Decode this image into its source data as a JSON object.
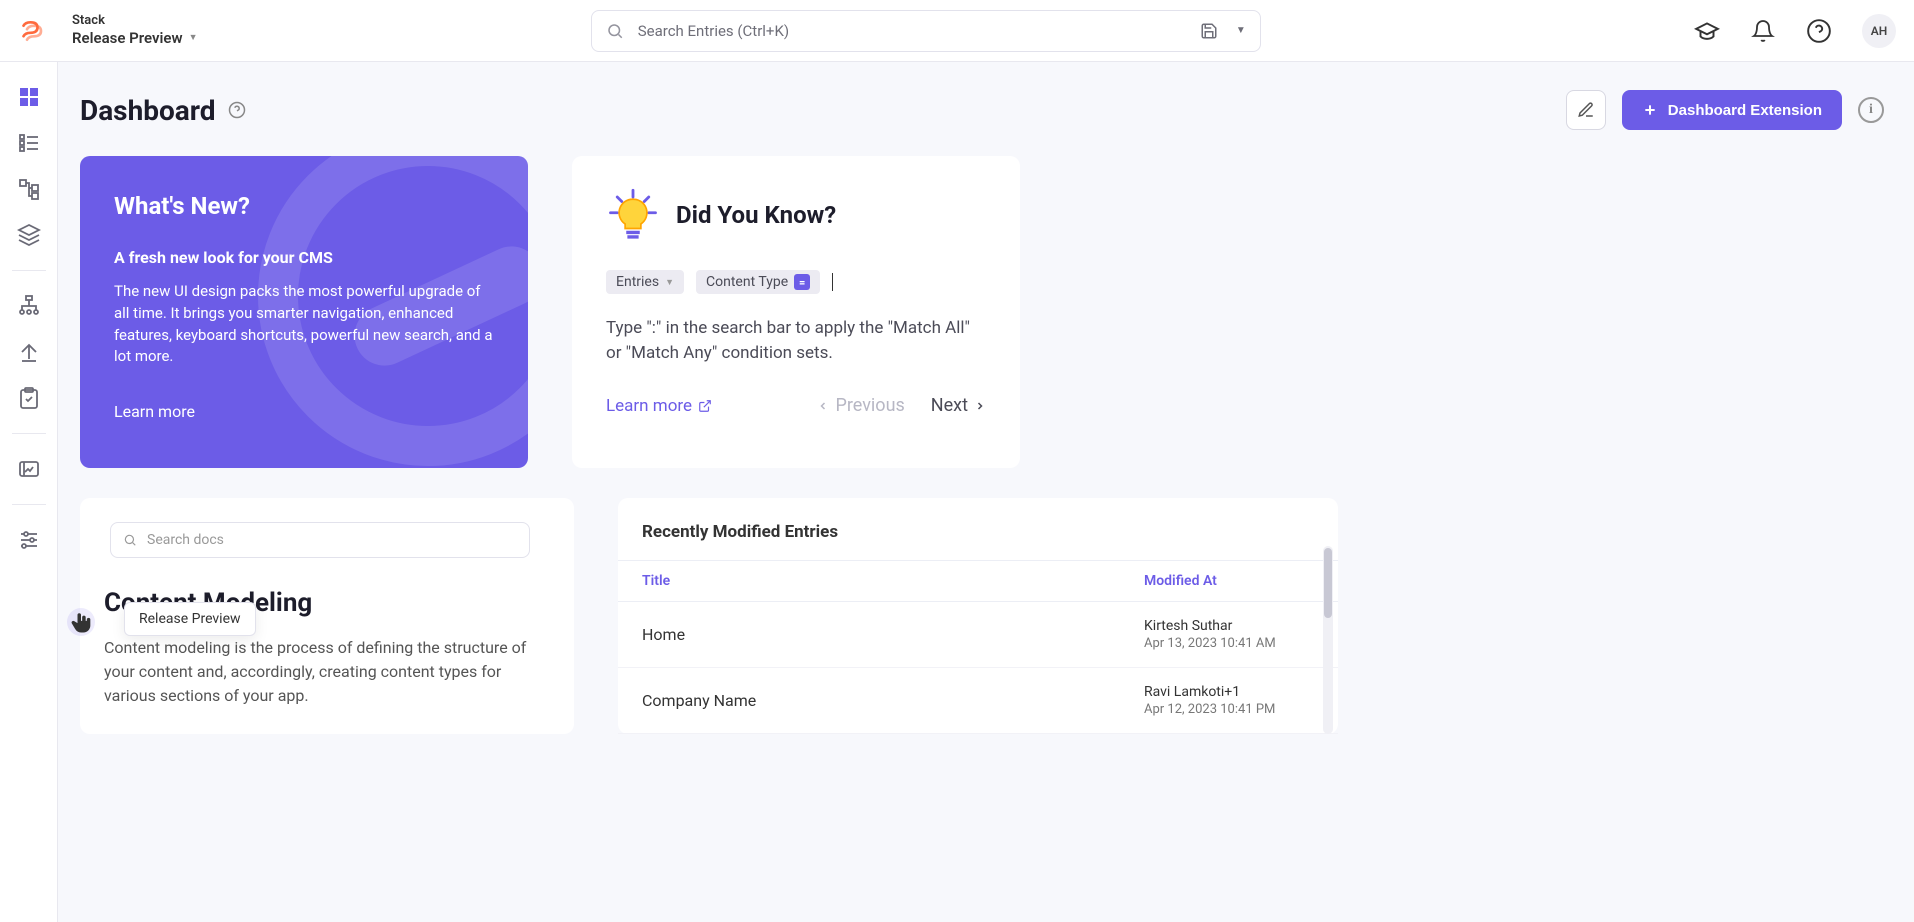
{
  "app": {
    "stack_label": "Stack",
    "stack_sub": "Release Preview"
  },
  "search": {
    "placeholder": "Search Entries (Ctrl+K)"
  },
  "topbar": {
    "avatar_initials": "AH"
  },
  "page": {
    "title": "Dashboard",
    "extension_btn": "Dashboard Extension"
  },
  "whats_new": {
    "heading": "What's New?",
    "sub": "A fresh new look for your CMS",
    "body": "The new UI design packs the most powerful upgrade of all time. It brings you smarter navigation, enhanced features, keyboard shortcuts, powerful new search, and a lot more.",
    "learn": "Learn more"
  },
  "did_you_know": {
    "title": "Did You Know?",
    "chip_entries": "Entries",
    "chip_content_type": "Content Type",
    "body": "Type \":\" in the search bar to apply the \"Match All\" or \"Match Any\" condition sets.",
    "learn": "Learn more",
    "prev": "Previous",
    "next": "Next"
  },
  "docs": {
    "search_placeholder": "Search docs",
    "cm_title": "Content Modeling",
    "cm_body": "Content modeling is the process of defining the structure of your content and, accordingly, creating content types for various sections of your app."
  },
  "recent": {
    "panel_title": "Recently Modified Entries",
    "col_title": "Title",
    "col_modified": "Modified At",
    "rows": [
      {
        "title": "Home",
        "by": "Kirtesh Suthar",
        "at": "Apr 13, 2023 10:41 AM"
      },
      {
        "title": "Company Name",
        "by": "Ravi Lamkoti+1",
        "at": "Apr 12, 2023 10:41 PM"
      }
    ]
  },
  "tooltip": {
    "text": "Release Preview"
  }
}
